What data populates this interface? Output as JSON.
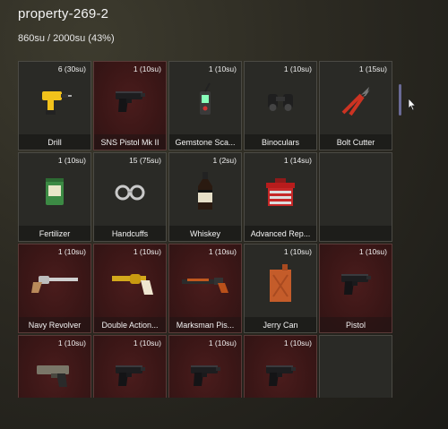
{
  "window": {
    "title": "property-269-2",
    "capacity": "860su / 2000su (43%)"
  },
  "slots": [
    {
      "name": "Drill",
      "count": "6 (30su)",
      "icon": "drill-icon",
      "weapon": false
    },
    {
      "name": "SNS Pistol Mk II",
      "count": "1 (10su)",
      "icon": "pistol-icon",
      "weapon": true
    },
    {
      "name": "Gemstone Sca...",
      "count": "1 (10su)",
      "icon": "scanner-icon",
      "weapon": false
    },
    {
      "name": "Binoculars",
      "count": "1 (10su)",
      "icon": "binoculars-icon",
      "weapon": false
    },
    {
      "name": "Bolt Cutter",
      "count": "1 (15su)",
      "icon": "bolt-cutter-icon",
      "weapon": false
    },
    {
      "name": "Fertilizer",
      "count": "1 (10su)",
      "icon": "fertilizer-bag-icon",
      "weapon": false
    },
    {
      "name": "Handcuffs",
      "count": "15 (75su)",
      "icon": "handcuffs-icon",
      "weapon": false
    },
    {
      "name": "Whiskey",
      "count": "1 (2su)",
      "icon": "whiskey-bottle-icon",
      "weapon": false
    },
    {
      "name": "Advanced Rep...",
      "count": "1 (14su)",
      "icon": "toolbox-icon",
      "weapon": false
    },
    {
      "name": "",
      "count": "",
      "icon": "",
      "weapon": false,
      "empty": true
    },
    {
      "name": "Navy Revolver",
      "count": "1 (10su)",
      "icon": "revolver-icon",
      "weapon": true
    },
    {
      "name": "Double Action...",
      "count": "1 (10su)",
      "icon": "gold-revolver-icon",
      "weapon": true
    },
    {
      "name": "Marksman Pis...",
      "count": "1 (10su)",
      "icon": "marksman-pistol-icon",
      "weapon": true
    },
    {
      "name": "Jerry Can",
      "count": "1 (10su)",
      "icon": "jerry-can-icon",
      "weapon": false
    },
    {
      "name": "Pistol",
      "count": "1 (10su)",
      "icon": "pistol-icon",
      "weapon": true
    },
    {
      "name": "",
      "count": "1 (10su)",
      "icon": "heavy-pistol-icon",
      "weapon": true
    },
    {
      "name": "",
      "count": "1 (10su)",
      "icon": "pistol-icon",
      "weapon": true
    },
    {
      "name": "",
      "count": "1 (10su)",
      "icon": "pistol-icon",
      "weapon": true
    },
    {
      "name": "",
      "count": "1 (10su)",
      "icon": "pistol-icon",
      "weapon": true
    },
    {
      "name": "",
      "count": "",
      "icon": "",
      "weapon": false,
      "empty": true
    }
  ]
}
